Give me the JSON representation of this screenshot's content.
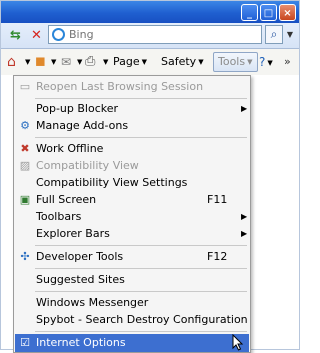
{
  "window": {
    "min_glyph": "_",
    "max_glyph": "□",
    "close_glyph": "×"
  },
  "search": {
    "placeholder": "Bing",
    "value": "",
    "go_glyph": "⌕"
  },
  "command_bar": {
    "page_label": "Page",
    "safety_label": "Safety",
    "tools_label": "Tools",
    "help_glyph": "?",
    "chevron_glyph": "»"
  },
  "menu": {
    "items": [
      {
        "label": "Reopen Last Browsing Session",
        "disabled": true,
        "icon": "reopen-session-icon"
      },
      {
        "label": "Pop-up Blocker",
        "submenu": true,
        "icon": "none"
      },
      {
        "label": "Manage Add-ons",
        "icon": "manage-addons-icon"
      },
      {
        "label": "Work Offline",
        "icon": "work-offline-icon"
      },
      {
        "label": "Compatibility View",
        "disabled": true,
        "icon": "compatibility-view-icon"
      },
      {
        "label": "Compatibility View Settings",
        "icon": "none"
      },
      {
        "label": "Full Screen",
        "accelerator": "F11",
        "icon": "full-screen-icon"
      },
      {
        "label": "Toolbars",
        "submenu": true,
        "icon": "none"
      },
      {
        "label": "Explorer Bars",
        "submenu": true,
        "icon": "none"
      },
      {
        "label": "Developer Tools",
        "accelerator": "F12",
        "icon": "developer-tools-icon"
      },
      {
        "label": "Suggested Sites",
        "icon": "none"
      },
      {
        "label": "Windows Messenger",
        "icon": "none"
      },
      {
        "label": "Spybot - Search  Destroy Configuration",
        "icon": "none"
      },
      {
        "label": "Internet Options",
        "selected": true,
        "icon": "internet-options-icon"
      }
    ]
  },
  "colors": {
    "titlebar": "#1f5fd0",
    "selection": "#3d6fd0",
    "disabled_text": "#9a9a9a"
  }
}
